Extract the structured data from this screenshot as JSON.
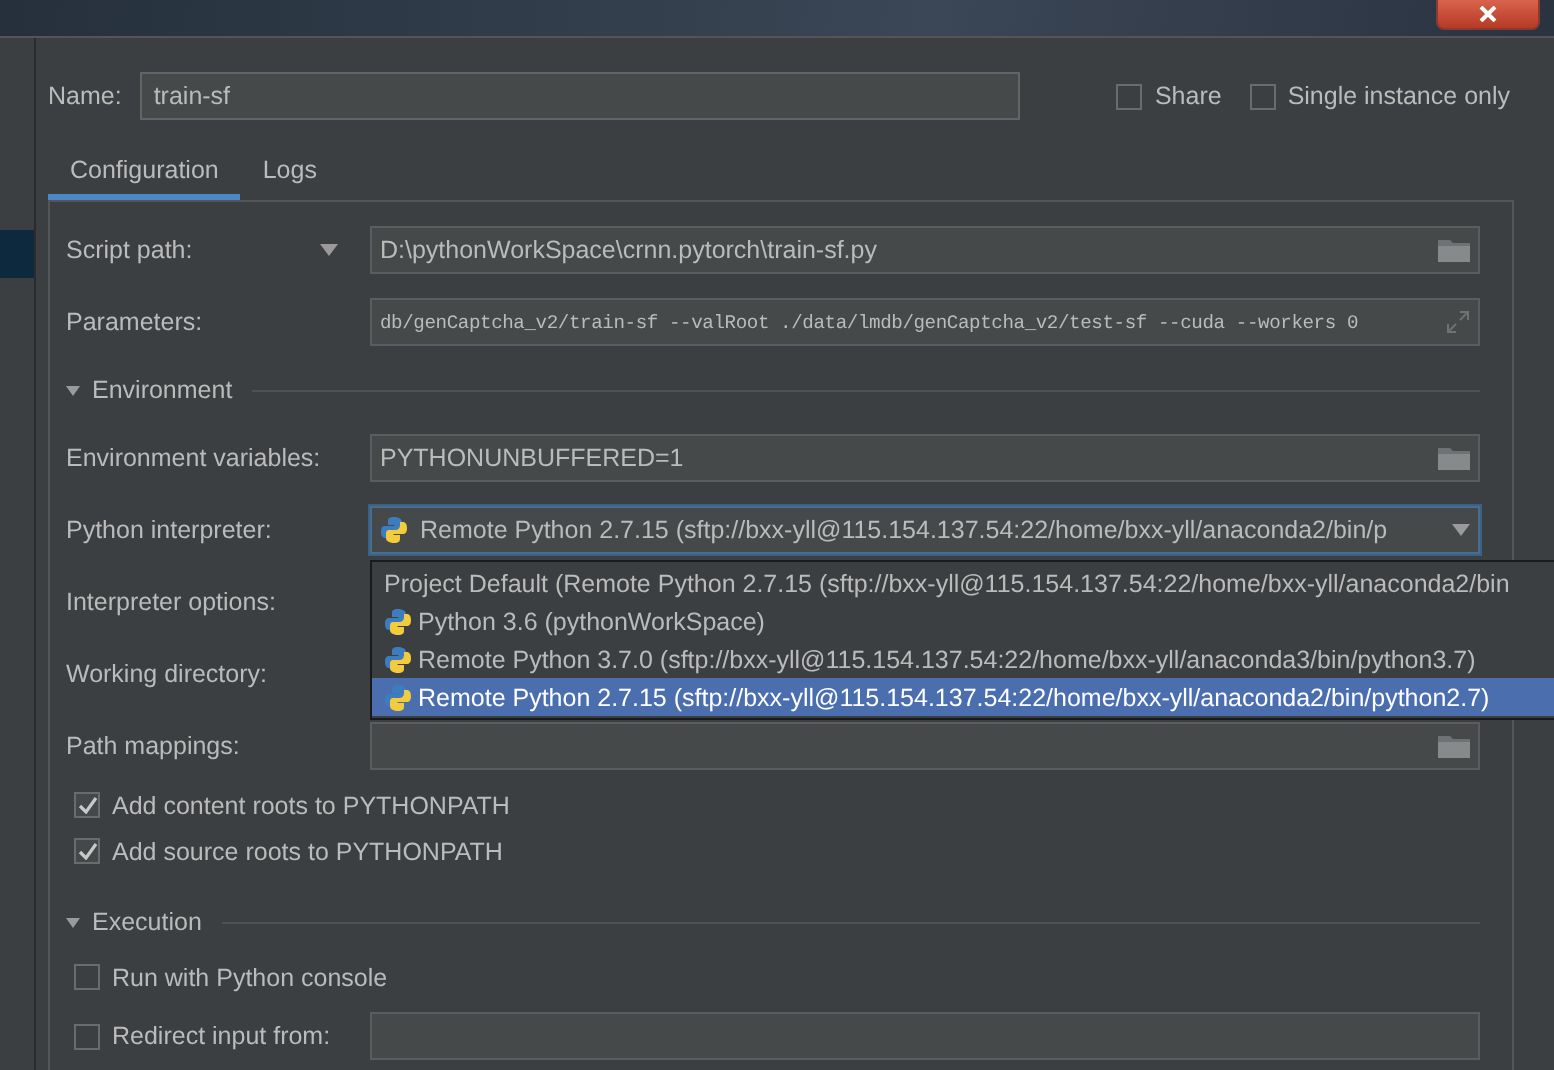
{
  "name_field": {
    "label": "Name:",
    "value": "train-sf"
  },
  "options": [
    {
      "label": "Share",
      "checked": false
    },
    {
      "label": "Single instance only",
      "checked": false
    }
  ],
  "tabs": [
    {
      "label": "Configuration",
      "selected": true
    },
    {
      "label": "Logs",
      "selected": false
    }
  ],
  "rows": [
    {
      "kind": "path",
      "label": "Script path:",
      "value": "D:\\pythonWorkSpace\\crnn.pytorch\\train-sf.py"
    },
    {
      "kind": "params",
      "label": "Parameters:",
      "value": "db/genCaptcha_v2/train-sf --valRoot ./data/lmdb/genCaptcha_v2/test-sf --cuda --workers 0"
    }
  ],
  "sections": [
    {
      "title": "Environment",
      "expanded": true,
      "rows": [
        {
          "kind": "field",
          "label": "Environment variables:",
          "value": "PYTHONUNBUFFERED=1"
        },
        {
          "kind": "dropdown",
          "label": "Python interpreter:",
          "value": "Remote Python 2.7.15 (sftp://bxx-yll@115.154.137.54:22/home/bxx-yll/anaconda2/bin/p",
          "popup": [
            {
              "label": "Project Default (Remote Python 2.7.15 (sftp://bxx-yll@115.154.137.54:22/home/bxx-yll/anaconda2/bin",
              "icon": false,
              "selected": false
            },
            {
              "label": "Python 3.6 (pythonWorkSpace)",
              "icon": true,
              "selected": false
            },
            {
              "label": "Remote Python 3.7.0 (sftp://bxx-yll@115.154.137.54:22/home/bxx-yll/anaconda3/bin/python3.7)",
              "icon": true,
              "selected": false
            },
            {
              "label": "Remote Python 2.7.15 (sftp://bxx-yll@115.154.137.54:22/home/bxx-yll/anaconda2/bin/python2.7)",
              "icon": true,
              "selected": true
            }
          ]
        },
        {
          "kind": "covered",
          "label": "Interpreter options:"
        },
        {
          "kind": "covered",
          "label": "Working directory:"
        },
        {
          "kind": "field",
          "label": "Path mappings:"
        },
        {
          "kind": "checkbox",
          "label": "Add content roots to PYTHONPATH",
          "checked": true
        },
        {
          "kind": "checkbox",
          "label": "Add source roots to PYTHONPATH",
          "checked": true
        }
      ]
    },
    {
      "title": "Execution",
      "expanded": true,
      "rows": [
        {
          "kind": "checkbox",
          "label": "Run with Python console",
          "checked": false
        },
        {
          "kind": "checkbox_field",
          "label": "Redirect input from:",
          "checked": false
        }
      ]
    }
  ]
}
